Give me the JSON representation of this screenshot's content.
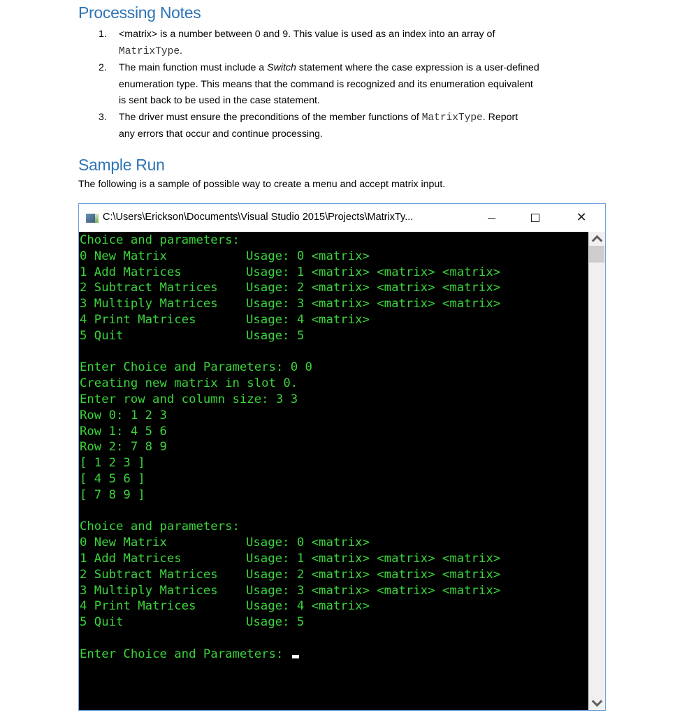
{
  "document": {
    "processing_notes_heading": "Processing Notes",
    "notes": [
      {
        "num": "1.",
        "parts": [
          "<matrix> is a number between 0 and 9.  This value is used as an index into an array of",
          "MatrixType",
          "."
        ]
      },
      {
        "num": "2.",
        "parts": [
          "The main function must include a ",
          "Switch",
          " statement where the case expression is a user-defined",
          "enumeration type.  This means that the command is recognized and its enumeration equivalent",
          "is sent back to be used in the case statement."
        ]
      },
      {
        "num": "3.",
        "parts": [
          "The driver must ensure the preconditions of the member functions of ",
          "MatrixType",
          ".  Report",
          "any errors that occur and continue processing."
        ]
      }
    ],
    "sample_run_heading": "Sample Run",
    "intro": "The following is a sample of possible way to create a menu and accept matrix input."
  },
  "console": {
    "title": "C:\\Users\\Erickson\\Documents\\Visual Studio 2015\\Projects\\MatrixTy...",
    "controls": {
      "minimize": "minimize",
      "maximize": "maximize",
      "close": "close"
    },
    "text_color": "#3BD43B",
    "background": "#000000",
    "lines": [
      {
        "left": "Choice and parameters:",
        "right": ""
      },
      {
        "left": "0 New Matrix",
        "right": "Usage: 0 <matrix>"
      },
      {
        "left": "1 Add Matrices",
        "right": "Usage: 1 <matrix> <matrix> <matrix>"
      },
      {
        "left": "2 Subtract Matrices",
        "right": "Usage: 2 <matrix> <matrix> <matrix>"
      },
      {
        "left": "3 Multiply Matrices",
        "right": "Usage: 3 <matrix> <matrix> <matrix>"
      },
      {
        "left": "4 Print Matrices",
        "right": "Usage: 4 <matrix>"
      },
      {
        "left": "5 Quit",
        "right": "Usage: 5"
      },
      {
        "left": "",
        "right": ""
      },
      {
        "left": "Enter Choice and Parameters: 0 0",
        "right": ""
      },
      {
        "left": "Creating new matrix in slot 0.",
        "right": ""
      },
      {
        "left": "Enter row and column size: 3 3",
        "right": ""
      },
      {
        "left": "Row 0: 1 2 3",
        "right": ""
      },
      {
        "left": "Row 1: 4 5 6",
        "right": ""
      },
      {
        "left": "Row 2: 7 8 9",
        "right": ""
      },
      {
        "left": "[ 1 2 3 ]",
        "right": ""
      },
      {
        "left": "[ 4 5 6 ]",
        "right": ""
      },
      {
        "left": "[ 7 8 9 ]",
        "right": ""
      },
      {
        "left": "",
        "right": ""
      },
      {
        "left": "Choice and parameters:",
        "right": ""
      },
      {
        "left": "0 New Matrix",
        "right": "Usage: 0 <matrix>"
      },
      {
        "left": "1 Add Matrices",
        "right": "Usage: 1 <matrix> <matrix> <matrix>"
      },
      {
        "left": "2 Subtract Matrices",
        "right": "Usage: 2 <matrix> <matrix> <matrix>"
      },
      {
        "left": "3 Multiply Matrices",
        "right": "Usage: 3 <matrix> <matrix> <matrix>"
      },
      {
        "left": "4 Print Matrices",
        "right": "Usage: 4 <matrix>"
      },
      {
        "left": "5 Quit",
        "right": "Usage: 5"
      },
      {
        "left": "",
        "right": ""
      },
      {
        "left": "Enter Choice and Parameters: ",
        "right": "",
        "cursor": true
      }
    ]
  }
}
